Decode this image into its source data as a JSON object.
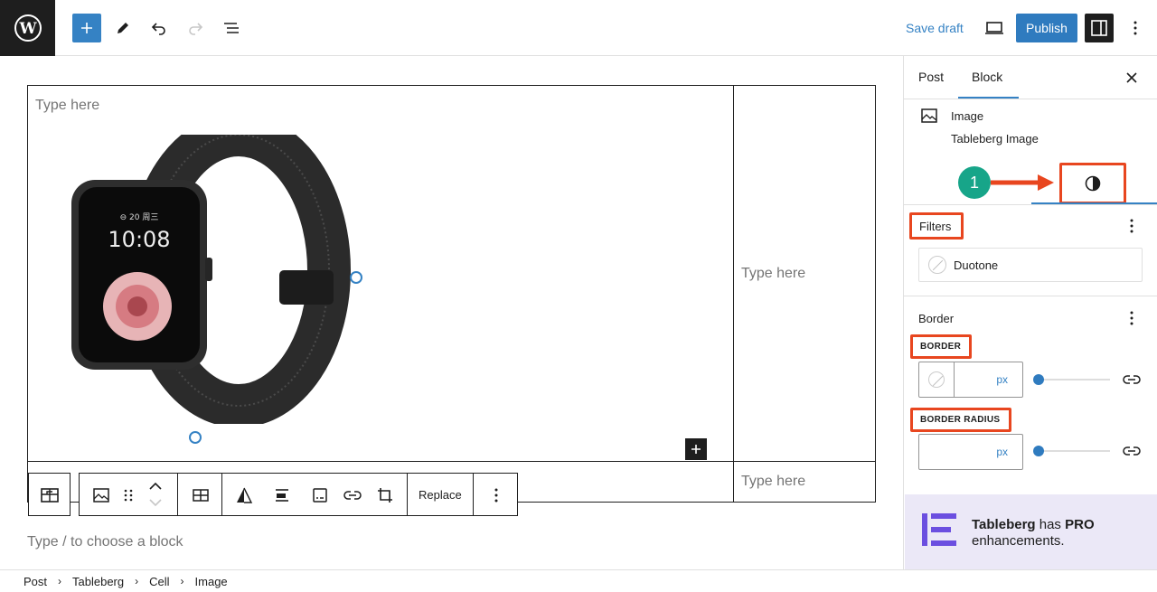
{
  "header": {
    "save_draft": "Save draft",
    "publish": "Publish"
  },
  "canvas": {
    "cell_top_left": "Type here",
    "cell_right": "Type here",
    "cell_bottom_right": "Type here",
    "choose_block": "Type / to choose a block",
    "toolbar_replace": "Replace"
  },
  "sidebar": {
    "tab_post": "Post",
    "tab_block": "Block",
    "block_name": "Image",
    "block_desc": "Tableberg Image",
    "step_number": "1",
    "filters_title": "Filters",
    "duotone_label": "Duotone",
    "border_panel_title": "Border",
    "border_label": "BORDER",
    "border_radius_label": "BORDER RADIUS",
    "unit": "px",
    "promo_brand": "Tableberg",
    "promo_has": "has",
    "promo_pro": "PRO",
    "promo_rest": "enhancements."
  },
  "breadcrumbs": [
    "Post",
    "Tableberg",
    "Cell",
    "Image"
  ],
  "colors": {
    "accent": "#3582c4",
    "highlight": "#e8461f",
    "step": "#17a589",
    "promo_bg": "#ebe8f7",
    "promo_logo": "#6b4fe0"
  }
}
